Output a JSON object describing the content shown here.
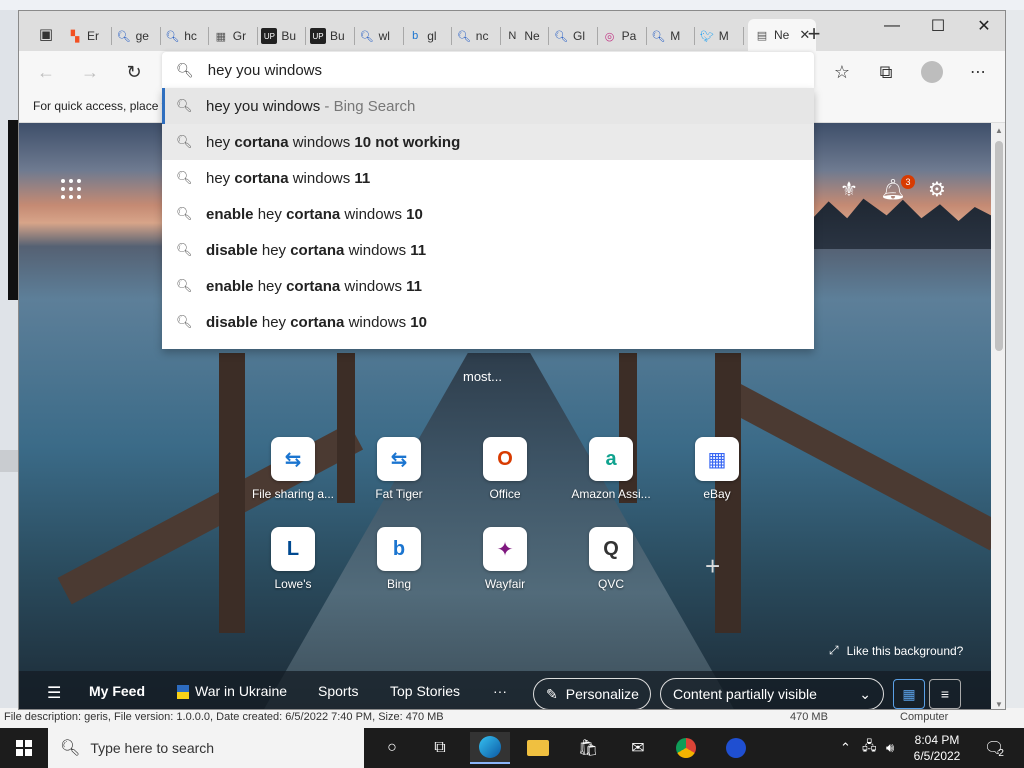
{
  "desktop": {
    "status_text": "File description: geris, File version: 1.0.0.0, Date created: 6/5/2022 7:40 PM, Size: 470 MB",
    "status_size": "470 MB",
    "status_computer": "Computer"
  },
  "browser": {
    "tabs": [
      {
        "label": "Er",
        "icon": "microsoft-icon"
      },
      {
        "label": "ge",
        "icon": "search-icon"
      },
      {
        "label": "hc",
        "icon": "search-icon"
      },
      {
        "label": "Gr",
        "icon": "calendar-icon"
      },
      {
        "label": "Bu",
        "icon": "up-icon"
      },
      {
        "label": "Bu",
        "icon": "up-icon"
      },
      {
        "label": "wl",
        "icon": "search-icon"
      },
      {
        "label": "gl",
        "icon": "bing-icon"
      },
      {
        "label": "nc",
        "icon": "search-icon"
      },
      {
        "label": "Ne",
        "icon": "news-icon"
      },
      {
        "label": "Gl",
        "icon": "search-icon"
      },
      {
        "label": "Pa",
        "icon": "instagram-icon"
      },
      {
        "label": "M",
        "icon": "search-icon"
      },
      {
        "label": "M",
        "icon": "twitter-icon"
      }
    ],
    "active_tab": {
      "label": "Ne",
      "close": "✕"
    },
    "new_tab": "+",
    "window": {
      "minimize": "—",
      "maximize": "☐",
      "close": "✕"
    },
    "favorites_hint": "For quick access, place y",
    "address_text": "hey you windows",
    "suggestions": [
      {
        "parts": [
          [
            "n",
            "hey you windows"
          ],
          [
            "g",
            " - Bing Search"
          ]
        ]
      },
      {
        "parts": [
          [
            "n",
            "hey "
          ],
          [
            "b",
            "cortana"
          ],
          [
            "n",
            " windows "
          ],
          [
            "b",
            "10 not working"
          ]
        ]
      },
      {
        "parts": [
          [
            "n",
            "hey "
          ],
          [
            "b",
            "cortana"
          ],
          [
            "n",
            " windows "
          ],
          [
            "b",
            "11"
          ]
        ]
      },
      {
        "parts": [
          [
            "b",
            "enable"
          ],
          [
            "n",
            " hey "
          ],
          [
            "b",
            "cortana"
          ],
          [
            "n",
            " windows "
          ],
          [
            "b",
            "10"
          ]
        ]
      },
      {
        "parts": [
          [
            "b",
            "disable"
          ],
          [
            "n",
            " hey "
          ],
          [
            "b",
            "cortana"
          ],
          [
            "n",
            " windows "
          ],
          [
            "b",
            "11"
          ]
        ]
      },
      {
        "parts": [
          [
            "b",
            "enable"
          ],
          [
            "n",
            " hey "
          ],
          [
            "b",
            "cortana"
          ],
          [
            "n",
            " windows "
          ],
          [
            "b",
            "11"
          ]
        ]
      },
      {
        "parts": [
          [
            "b",
            "disable"
          ],
          [
            "n",
            " hey "
          ],
          [
            "b",
            "cortana"
          ],
          [
            "n",
            " windows "
          ],
          [
            "b",
            "10"
          ]
        ]
      }
    ]
  },
  "newtab": {
    "notification_count": "3",
    "recent_text": "most...",
    "tiles_row1": [
      {
        "label": "File sharing a...",
        "icon": "fileshare-icon",
        "glyph": "⇆",
        "color": "#1b75d0"
      },
      {
        "label": "Fat Tiger",
        "icon": "fat-tiger-icon",
        "glyph": "⇆",
        "color": "#1b75d0"
      },
      {
        "label": "Office",
        "icon": "office-icon",
        "glyph": "O",
        "color": "#d83b01"
      },
      {
        "label": "Amazon Assi...",
        "icon": "amazon-assistant-icon",
        "glyph": "a",
        "color": "#10a38f"
      },
      {
        "label": "eBay",
        "icon": "ebay-icon",
        "glyph": "▦",
        "color": "#3665f3"
      }
    ],
    "tiles_row2": [
      {
        "label": "Lowe's",
        "icon": "lowes-icon",
        "glyph": "L",
        "color": "#004990"
      },
      {
        "label": "Bing",
        "icon": "bing-icon",
        "glyph": "b",
        "color": "#1b75d0"
      },
      {
        "label": "Wayfair",
        "icon": "wayfair-icon",
        "glyph": "✦",
        "color": "#7f187f"
      },
      {
        "label": "QVC",
        "icon": "qvc-icon",
        "glyph": "Q",
        "color": "#333333"
      }
    ],
    "like_background": "Like this background?",
    "feed": {
      "my_feed": "My Feed",
      "items": [
        "War in Ukraine",
        "Sports",
        "Top Stories"
      ],
      "more": "···",
      "personalize": "Personalize",
      "content_visibility": "Content partially visible"
    }
  },
  "taskbar": {
    "search_placeholder": "Type here to search",
    "time": "8:04 PM",
    "date": "6/5/2022",
    "notification_count": "2"
  }
}
